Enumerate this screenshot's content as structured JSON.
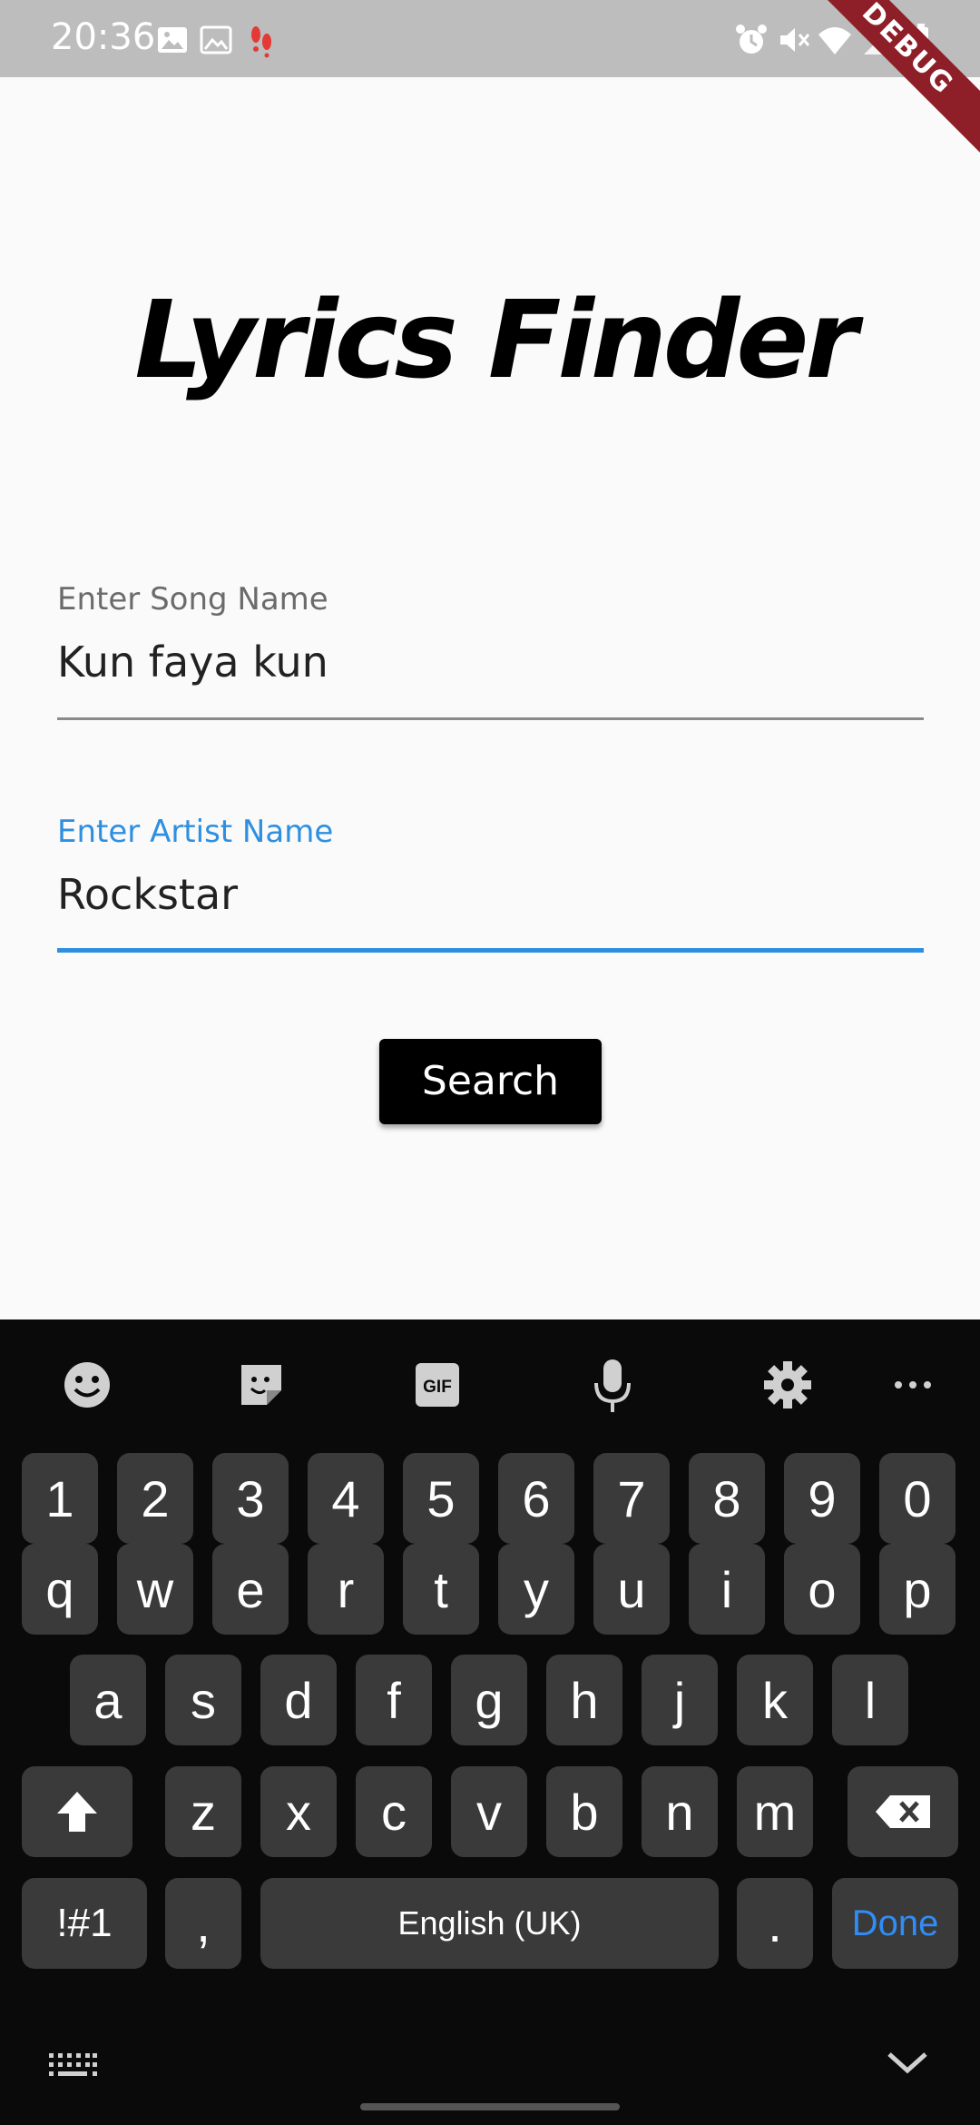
{
  "status_bar": {
    "time": "20:36",
    "debug_label": "DEBUG",
    "icons": [
      "image-icon",
      "photo-icon",
      "footprints-icon",
      "alarm-icon",
      "mute-icon",
      "wifi-icon",
      "signal-icon",
      "battery-icon"
    ]
  },
  "app": {
    "title": "Lyrics Finder",
    "song_field": {
      "label": "Enter Song Name",
      "value": "Kun faya kun"
    },
    "artist_field": {
      "label": "Enter Artist Name",
      "value": "Rockstar"
    },
    "search_label": "Search"
  },
  "keyboard": {
    "toolbar": [
      "emoji-icon",
      "sticker-icon",
      "gif-icon",
      "microphone-icon",
      "settings-icon",
      "more-icon"
    ],
    "gif_text": "GIF",
    "number_row": [
      "1",
      "2",
      "3",
      "4",
      "5",
      "6",
      "7",
      "8",
      "9",
      "0"
    ],
    "row1": [
      "q",
      "w",
      "e",
      "r",
      "t",
      "y",
      "u",
      "i",
      "o",
      "p"
    ],
    "row2": [
      "a",
      "s",
      "d",
      "f",
      "g",
      "h",
      "j",
      "k",
      "l"
    ],
    "row3": [
      "z",
      "x",
      "c",
      "v",
      "b",
      "n",
      "m"
    ],
    "symbols_label": "!#1",
    "comma_label": ",",
    "space_label": "English (UK)",
    "period_label": ".",
    "done_label": "Done"
  },
  "colors": {
    "accent": "#2e8fe0",
    "keyboard_bg": "#0a0a0a",
    "key_bg": "#3a3a3a",
    "debug_ribbon": "#8e1f28"
  }
}
